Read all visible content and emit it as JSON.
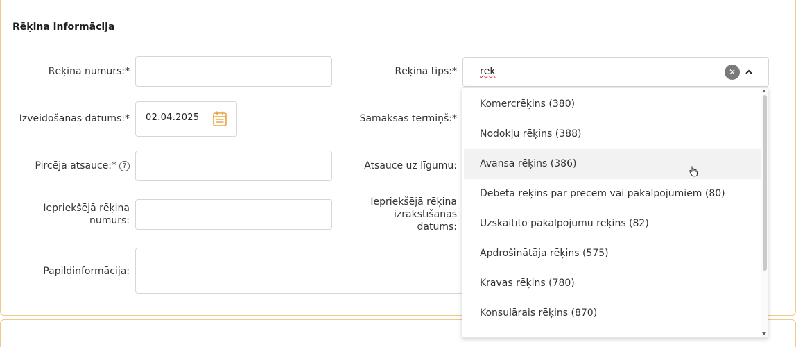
{
  "section": {
    "title": "Rēķina informācija"
  },
  "fields": {
    "invoice_number": {
      "label": "Rēķina numurs:*",
      "value": ""
    },
    "creation_date": {
      "label": "Izveidošanas datums:*",
      "value": "02.04.2025"
    },
    "buyer_reference": {
      "label": "Pircēja atsauce:*",
      "value": "",
      "help": "?"
    },
    "previous_invoice_number": {
      "label_line1": "Iepriekšējā rēķina",
      "label_line2": "numurs:",
      "value": ""
    },
    "additional_info": {
      "label": "Papildinformācija:",
      "value": ""
    },
    "invoice_type": {
      "label": "Rēķina tips:*",
      "value": "rēk"
    },
    "payment_term": {
      "label": "Samaksas termiņš:*"
    },
    "contract_reference": {
      "label": "Atsauce uz līgumu:"
    },
    "previous_invoice_date": {
      "label_line1": "Iepriekšējā rēķina",
      "label_line2": "izrakstīšanas",
      "label_line3": "datums:"
    }
  },
  "dropdown": {
    "options": [
      "Komercrēķins (380)",
      "Nodokļu rēķins (388)",
      "Avansa rēķins (386)",
      "Debeta rēķins par precēm vai pakalpojumiem (80)",
      "Uzskaitīto pakalpojumu rēķins (82)",
      "Apdrošinātāja rēķins (575)",
      "Kravas rēķins (780)",
      "Konsulārais rēķins (870)"
    ],
    "hovered_index": 2
  },
  "icons": {
    "calendar": "calendar-icon",
    "help": "help-circle-icon",
    "clear": "clear-icon",
    "chevron": "chevron-up-icon"
  },
  "colors": {
    "accent": "#e8a33d",
    "border": "#f0c98a"
  }
}
